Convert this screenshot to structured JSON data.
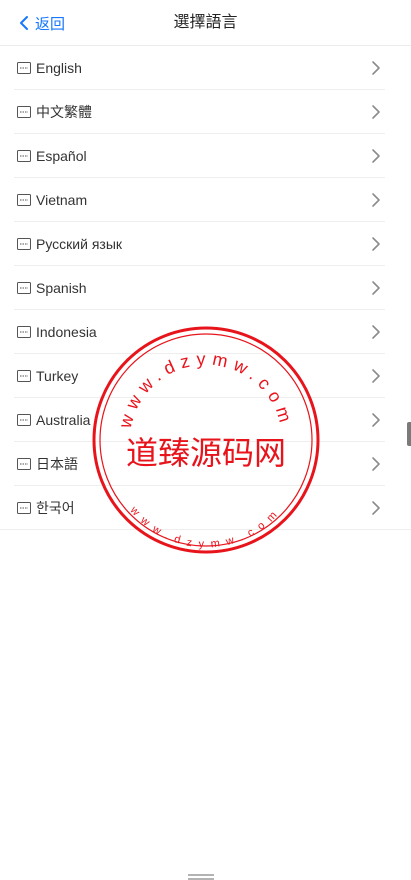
{
  "header": {
    "back_label": "返回",
    "title": "選擇語言"
  },
  "languages": [
    {
      "label": "English"
    },
    {
      "label": "中文繁體"
    },
    {
      "label": "Español"
    },
    {
      "label": "Vietnam"
    },
    {
      "label": "Русский язык"
    },
    {
      "label": "Spanish"
    },
    {
      "label": "Indonesia"
    },
    {
      "label": "Turkey"
    },
    {
      "label": "Australia"
    },
    {
      "label": "日本語"
    },
    {
      "label": "한국어"
    }
  ],
  "watermark": {
    "center_text": "道臻源码网",
    "outer_text": "www.dzymw.com",
    "inner_text": "www.dzymw.com",
    "color": "#e8141c"
  },
  "colors": {
    "accent": "#1677ff",
    "text": "#333333",
    "icon": "#555555",
    "chevron": "#8c8c8c",
    "divider": "#eeeeee"
  },
  "icons": {
    "row_icon": "keyboard-icon",
    "row_action": "chevron-right-icon",
    "back": "chevron-left-icon"
  }
}
